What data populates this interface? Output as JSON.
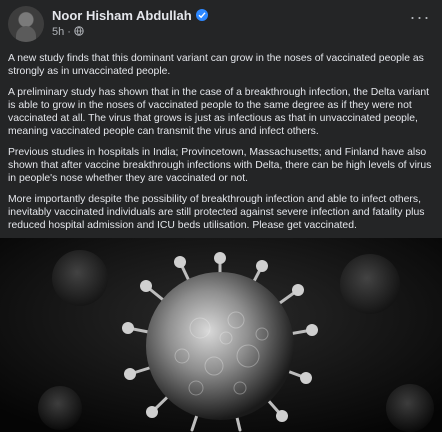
{
  "post": {
    "author": "Noor Hisham Abdullah",
    "time": "5h",
    "separator": "·",
    "more_label": "···",
    "paragraphs": [
      "A new study finds that this dominant variant can grow in the noses of vaccinated people as strongly as in unvaccinated people.",
      "A preliminary study has shown that in the case of a breakthrough infection, the Delta variant is able to grow in the noses of vaccinated people to the same degree as if they were not vaccinated at all. The virus that grows is just as infectious as that in unvaccinated people, meaning vaccinated people can transmit the virus and infect others.",
      "Previous studies in hospitals in India; Provincetown, Massachusetts; and Finland have also shown that after vaccine breakthrough infections with Delta, there can be high levels of virus in people's nose whether they are vaccinated or not.",
      "More importantly despite the possibility of breakthrough infection and able to infect others, inevitably vaccinated individuals are still protected against severe infection and fatality plus reduced hospital admission and ICU beds utilisation. Please get vaccinated."
    ]
  },
  "icons": {
    "verified": "verified-badge-icon",
    "audience": "globe-icon",
    "more": "more-icon"
  },
  "colors": {
    "background": "#242526",
    "text": "#e4e6eb",
    "secondary": "#b0b3b8",
    "verified": "#2d88ff"
  }
}
